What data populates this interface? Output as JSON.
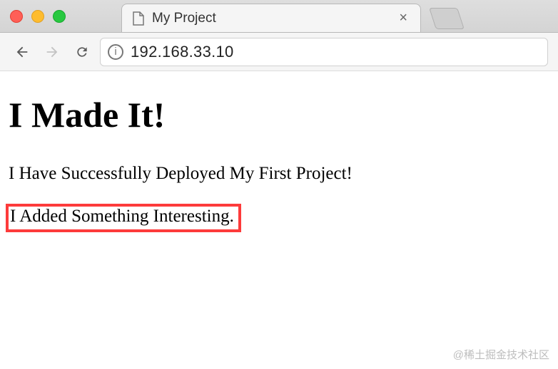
{
  "window": {
    "traffic": {
      "red": "#ff5f57",
      "yellow": "#febc2e",
      "green": "#28c840"
    }
  },
  "tab": {
    "title": "My Project",
    "close_glyph": "×"
  },
  "address_bar": {
    "url": "192.168.33.10",
    "info_glyph": "i"
  },
  "content": {
    "heading": "I Made It!",
    "line1": "I Have Successfully Deployed My First Project!",
    "line2": "I Added Something Interesting."
  },
  "watermark": "@稀土掘金技术社区"
}
